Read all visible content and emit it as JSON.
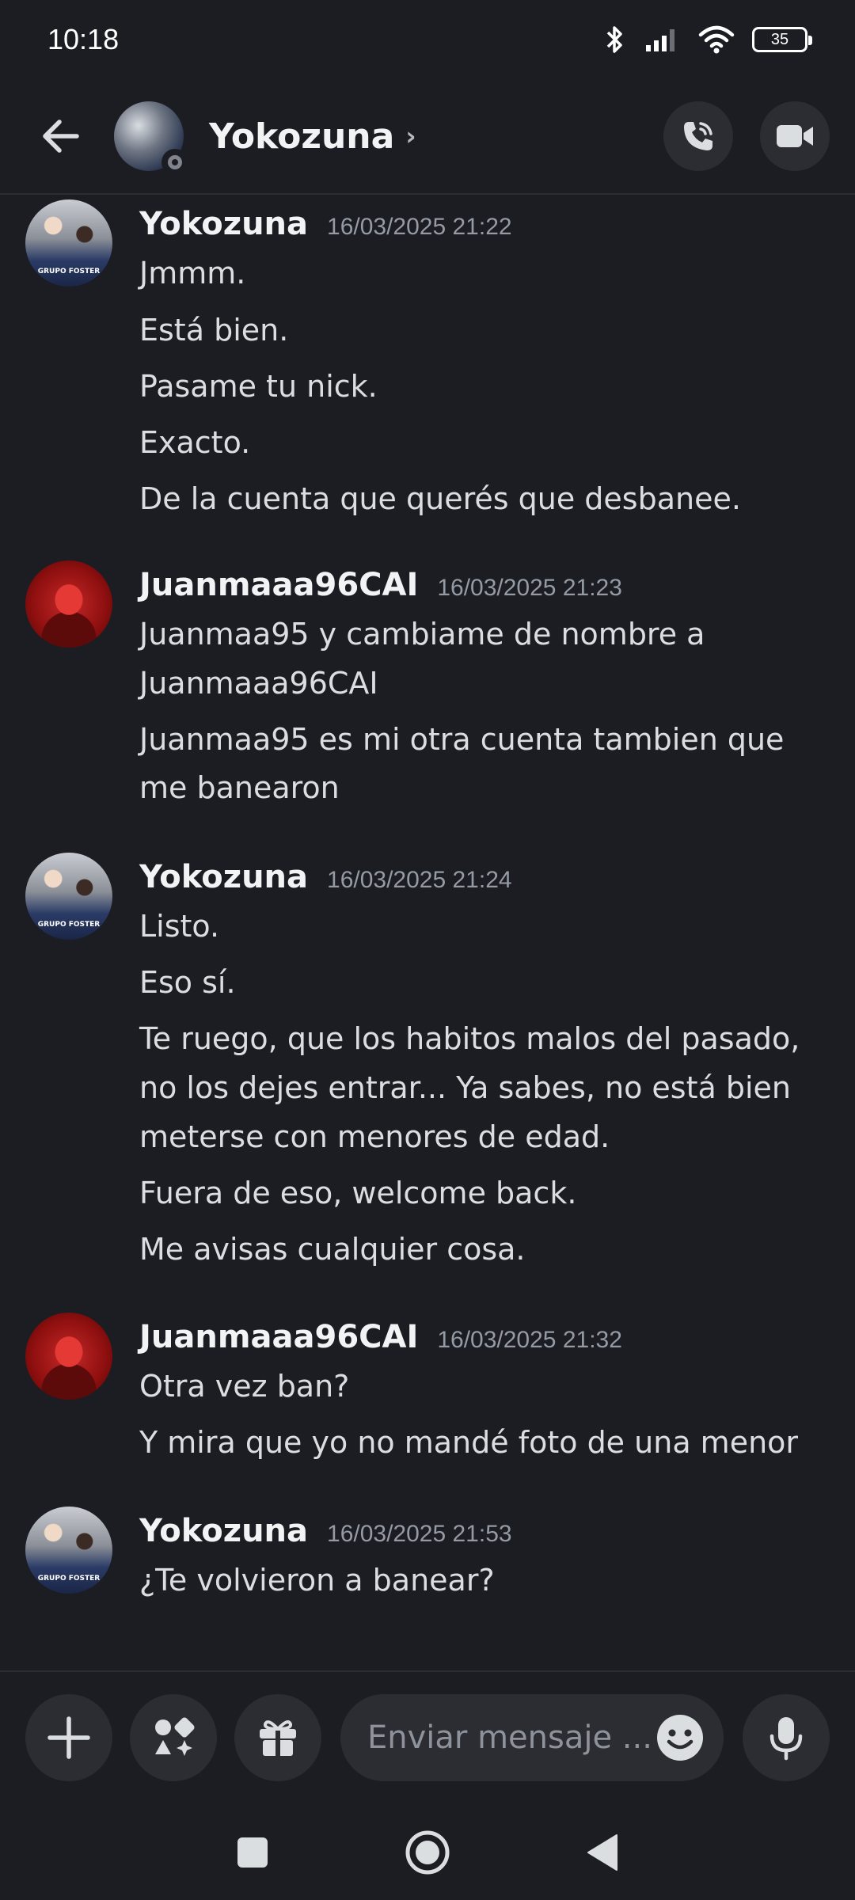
{
  "status_bar": {
    "time": "10:18",
    "battery": "35"
  },
  "header": {
    "title": "Yokozuna",
    "chevron": "›"
  },
  "messages": [
    {
      "author": "Yokozuna",
      "avatar": "yokozuna-avatar",
      "timestamp": "16/03/2025 21:22",
      "lines": [
        "Jmmm.",
        "Está bien.",
        "Pasame tu nick.",
        "Exacto.",
        "De la cuenta que querés que desbanee."
      ]
    },
    {
      "author": "Juanmaaa96CAI",
      "avatar": "juanmaaa-avatar",
      "timestamp": "16/03/2025 21:23",
      "lines": [
        "Juanmaa95 y cambiame de nombre a",
        "Juanmaaa96CAI",
        "Juanmaa95 es mi otra cuenta tambien que",
        "me banearon"
      ]
    },
    {
      "author": "Yokozuna",
      "avatar": "yokozuna-avatar",
      "timestamp": "16/03/2025 21:24",
      "lines": [
        "Listo.",
        "Eso sí.",
        "Te ruego, que los habitos malos del pasado,",
        "no los dejes entrar... Ya sabes, no está bien",
        "meterse con menores de edad.",
        "Fuera de eso, welcome back.",
        "Me avisas cualquier cosa."
      ]
    },
    {
      "author": "Juanmaaa96CAI",
      "avatar": "juanmaaa-avatar",
      "timestamp": "16/03/2025 21:32",
      "lines": [
        "Otra vez ban?",
        "Y mira que yo no mandé foto de una menor"
      ]
    },
    {
      "author": "Yokozuna",
      "avatar": "yokozuna-avatar",
      "timestamp": "16/03/2025 21:53",
      "lines": [
        "¿Te volvieron a banear?"
      ]
    }
  ],
  "composer": {
    "placeholder": "Enviar mensaje ...",
    "value": ""
  },
  "icons": {
    "back": "arrow-left-icon",
    "call": "phone-icon",
    "video": "video-camera-icon",
    "add": "plus-icon",
    "apps": "apps-icon",
    "gift": "gift-icon",
    "emoji": "smiley-icon",
    "mic": "microphone-icon"
  },
  "colors": {
    "background": "#1c1d22",
    "surface": "#2b2d33",
    "text": "#dbdee1",
    "muted": "#949ba4"
  }
}
